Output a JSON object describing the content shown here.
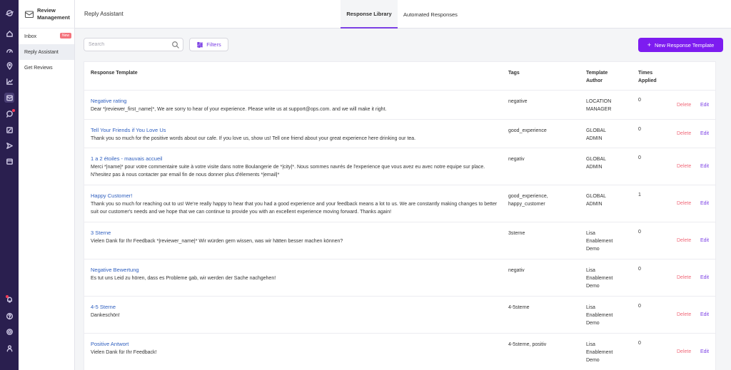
{
  "sidebar": {
    "title_line1": "Review",
    "title_line2": "Management",
    "items": [
      {
        "label": "Inbox",
        "badge": "New"
      },
      {
        "label": "Reply Assistant"
      },
      {
        "label": "Get Reviews"
      }
    ]
  },
  "header": {
    "app_title": "Reply Assistant",
    "tabs": [
      {
        "label": "Response Library",
        "active": true
      },
      {
        "label": "Automated Responses",
        "active": false
      }
    ]
  },
  "controls": {
    "search_placeholder": "Search",
    "filters_label": "Filters",
    "new_button_label": "New Response Template"
  },
  "table": {
    "headers": {
      "template": "Response Template",
      "tags": "Tags",
      "author_line1": "Template",
      "author_line2": "Author",
      "times_line1": "Times",
      "times_line2": "Applied"
    },
    "delete_label": "Delete",
    "edit_label": "Edit",
    "rows": [
      {
        "name": "Negative rating",
        "body": "Dear *|reviewer_first_name|*, We are sorry to hear of your experience. Please write us at support@ops.com. and we will make it right.",
        "tags": "negative",
        "author": "LOCATION\nMANAGER",
        "times": "0"
      },
      {
        "name": "Tell Your Friends if You Love Us",
        "body": "Thank you so much for the positive words about our cafe. If you love us, show us! Tell one friend about your great experience here drinking our tea.",
        "tags": "good_experience",
        "author": "GLOBAL\nADMIN",
        "times": "0"
      },
      {
        "name": "1 a 2 étoiles - mauvais accueil",
        "body": "Merci *|name|* pour votre commentaire suite à votre visite dans notre Boulangerie de *|city|*. Nous sommes navrés de l'experience que vous avez eu avec notre equipe sur place. N'hesitez pas à nous contacter par email fin de nous donner plus d'élements *|email|*",
        "tags": "negativ",
        "author": "GLOBAL\nADMIN",
        "times": "0"
      },
      {
        "name": "Happy Customer!",
        "body": "Thank you so much for reaching out to us! We're really happy to hear that you had a good experience and your feedback means a lot to us. We are constantly making changes to better suit our customer's needs and we hope that we can continue to provide you with an excellent experience moving forward. Thanks again!",
        "tags": "good_experience,\nhappy_customer",
        "author": "GLOBAL\nADMIN",
        "times": "1"
      },
      {
        "name": "3 Sterne",
        "body": "Vielen Dank für Ihr Feedback *|reviewer_name|* Wir würden gern wissen, was wir hätten besser machen können?",
        "tags": "3sterne",
        "author": "Lisa\nEnablement\nDemo",
        "times": "0"
      },
      {
        "name": "Negative Bewertung",
        "body": "Es tut uns Leid zu hören, dass es Probleme gab, wir werden der Sache nachgehen!",
        "tags": "negativ",
        "author": "Lisa\nEnablement\nDemo",
        "times": "0"
      },
      {
        "name": "4-5 Sterne",
        "body": "Dankeschön!",
        "tags": "4-5sterne",
        "author": "Lisa\nEnablement\nDemo",
        "times": "0"
      },
      {
        "name": "Positive Antwort",
        "body": "Vielen Dank für Ihr Feedback!",
        "tags": "4-5sterne, positiv",
        "author": "Lisa\nEnablement\nDemo",
        "times": "0"
      }
    ]
  },
  "colors": {
    "accent": "#7d1cf0",
    "rail": "#2a1f4f",
    "delete": "#f06a7a",
    "link": "#2f5fbf"
  },
  "rail_icons": [
    "logo-icon",
    "home-icon",
    "dashboard-icon",
    "location-icon",
    "chart-icon",
    "reviews-icon",
    "chat-icon",
    "edit-icon",
    "send-icon",
    "calendar-icon",
    "notification-icon",
    "help-icon",
    "settings-icon",
    "user-icon"
  ]
}
